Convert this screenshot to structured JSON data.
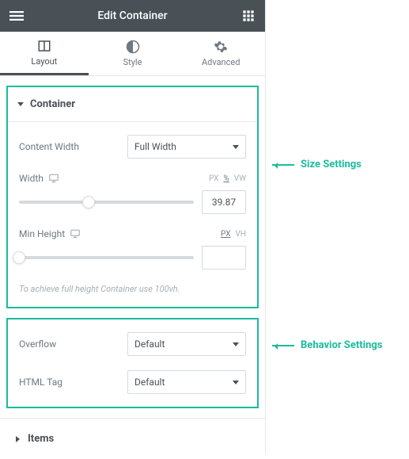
{
  "header": {
    "title": "Edit Container"
  },
  "tabs": {
    "layout": "Layout",
    "style": "Style",
    "advanced": "Advanced"
  },
  "sections": {
    "container": {
      "title": "Container",
      "contentWidth": {
        "label": "Content Width",
        "value": "Full Width"
      },
      "width": {
        "label": "Width",
        "value": "39.87",
        "units": [
          "PX",
          "%",
          "VW"
        ],
        "activeUnit": "%",
        "sliderPos": 40
      },
      "minHeight": {
        "label": "Min Height",
        "value": "",
        "units": [
          "PX",
          "VH"
        ],
        "activeUnit": "PX",
        "sliderPos": 0
      },
      "hint": "To achieve full height Container use 100vh."
    },
    "behavior": {
      "overflow": {
        "label": "Overflow",
        "value": "Default"
      },
      "htmlTag": {
        "label": "HTML Tag",
        "value": "Default"
      }
    },
    "items": {
      "title": "Items"
    }
  },
  "callouts": {
    "size": "Size Settings",
    "behavior": "Behavior Settings"
  }
}
